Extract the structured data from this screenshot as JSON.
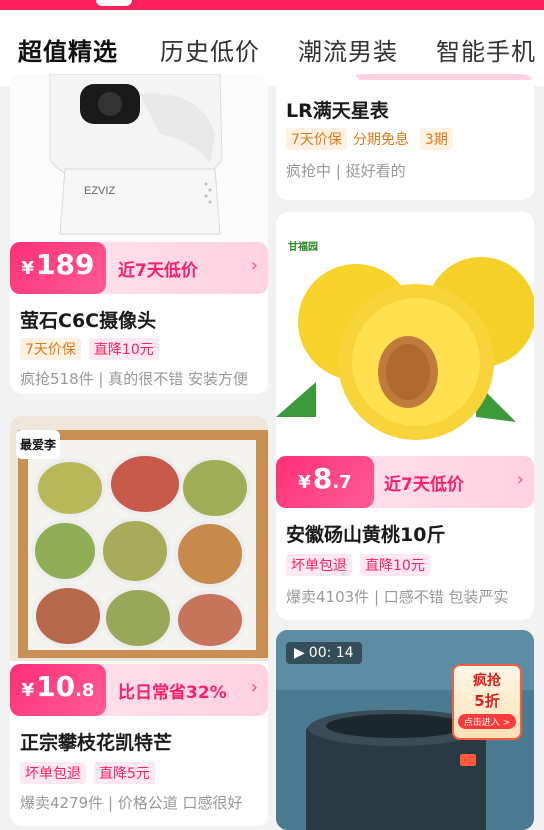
{
  "tabs": [
    {
      "label": "超值精选"
    },
    {
      "label": "历史低价"
    },
    {
      "label": "潮流男装"
    },
    {
      "label": "智能手机"
    }
  ],
  "left": {
    "camera": {
      "price_int": "189",
      "price_dec": "",
      "yen": "¥",
      "price_tag": "近7天低价",
      "title": "萤石C6C摄像头",
      "tags": [
        "7天价保",
        "直降10元"
      ],
      "meta": "疯抢518件 | 真的很不错 安装方便",
      "camera_brand": "EZVIZ"
    },
    "mango": {
      "badge": "最爱李",
      "price_int": "10",
      "price_dec": ".8",
      "yen": "¥",
      "price_tag": "比日常省32%",
      "title": "正宗攀枝花凯特芒",
      "tags": [
        "坏单包退",
        "直降5元"
      ],
      "meta": "爆卖4279件 | 价格公道 口感很好"
    }
  },
  "right": {
    "watch": {
      "title": "LR满天星表",
      "tags": [
        "7天价保",
        "分期免息",
        "3期"
      ],
      "meta": "疯抢中 | 挺好看的"
    },
    "peach": {
      "badge": "甘福园",
      "price_int": "8",
      "price_dec": ".7",
      "yen": "¥",
      "price_tag": "近7天低价",
      "title": "安徽砀山黄桃10斤",
      "tags": [
        "坏单包退",
        "直降10元"
      ],
      "meta": "爆卖4103件 | 口感不错 包装严实"
    },
    "speaker": {
      "video_time": "00: 14",
      "promo_line1": "疯抢",
      "promo_line2": "5折",
      "promo_btn": "点击进入 >"
    }
  },
  "colors": {
    "accent": "#ff1f5a",
    "price_pink": "#ff2f78"
  }
}
